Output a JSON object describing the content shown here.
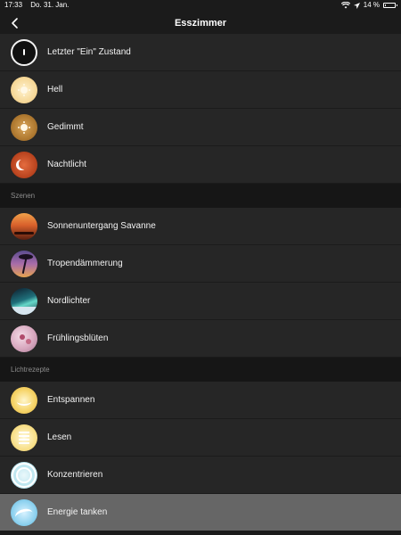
{
  "status": {
    "time": "17:33",
    "date": "Do. 31. Jan.",
    "battery": "14 %",
    "battery_level": 0.14
  },
  "nav": {
    "title": "Esszimmer",
    "back_icon": "chevron-left-icon"
  },
  "states": [
    {
      "label": "Letzter \"Ein\" Zustand",
      "icon": "power-icon"
    },
    {
      "label": "Hell",
      "icon": "sun-bright-icon"
    },
    {
      "label": "Gedimmt",
      "icon": "sun-dim-icon"
    },
    {
      "label": "Nachtlicht",
      "icon": "moon-icon"
    }
  ],
  "sections": {
    "scenes": "Szenen",
    "recipes": "Lichtrezepte"
  },
  "scenes": [
    {
      "label": "Sonnenuntergang Savanne",
      "icon": "scene-sunset-thumbnail"
    },
    {
      "label": "Tropendämmerung",
      "icon": "scene-tropical-thumbnail"
    },
    {
      "label": "Nordlichter",
      "icon": "scene-aurora-thumbnail"
    },
    {
      "label": "Frühlingsblüten",
      "icon": "scene-blossom-thumbnail"
    }
  ],
  "recipes": [
    {
      "label": "Entspannen",
      "icon": "relax-icon"
    },
    {
      "label": "Lesen",
      "icon": "read-icon"
    },
    {
      "label": "Konzentrieren",
      "icon": "concentrate-icon"
    },
    {
      "label": "Energie tanken",
      "icon": "energize-icon",
      "selected": true
    }
  ],
  "colors": {
    "background": "#1b1b1b",
    "row": "#262626",
    "section_header": "#161616",
    "selected_row": "#666666"
  }
}
